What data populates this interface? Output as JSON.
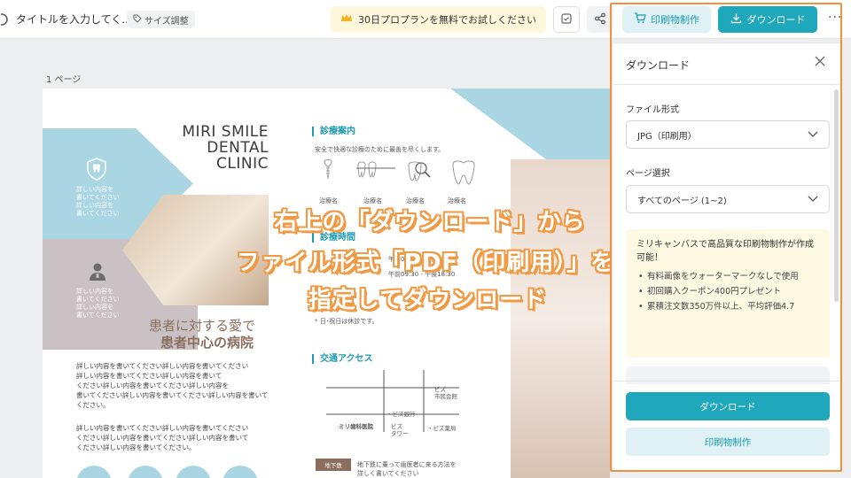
{
  "topbar": {
    "title": "タイトルを入力してく...",
    "size_button": "サイズ調整",
    "promo": "30日プロプランを無料でお試しください",
    "print_button": "印刷物制作",
    "download_button": "ダウンロード",
    "more": "···"
  },
  "canvas": {
    "page_label": "1 ページ",
    "doc": {
      "brand_line1": "MIRI SMILE",
      "brand_line2": "DENTAL",
      "brand_line3": "CLINIC",
      "side_text_1": "詳しい内容を\n書いてください\n詳しい内容を\n書いてください",
      "side_text_2": "詳しい内容を\n書いてください\n詳しい内容を\n書いてください",
      "slogan1": "患者に対する愛で",
      "slogan2": "患者中心の病院",
      "body1": "詳しい内容を書いてください詳しい内容を書いてください\n詳しい内容を書いてください詳しい内容を書いて\nください詳しい内容を書いてください詳しい内容を\n書いてください詳しい内容を書いてください詳しい内容を書いて\nください。",
      "body2": "詳しい内容を書いてください詳しい内容を書いてください\nください詳しい内容を書いてください詳しい内容を書いて\nください詳しい内容を書いてください。",
      "sec1": "診療案内",
      "sec1_sub": "安全で快適な診療のために最善を尽くします。",
      "tooth_labels": [
        "治療名",
        "治療名",
        "治療名",
        "治療名"
      ],
      "sec2": "診療時間",
      "hours1": "午前09:30 - 午後18:30",
      "hours2": "午前09:30 - 午後18:30",
      "holiday": "* 日･祝日は休診です。",
      "sec3": "交通アクセス",
      "map_bank": "・ビズ銀行",
      "map_city": "ビズ\n市民会館",
      "map_tower": "ビズ\nタワー",
      "map_pharmacy": "・ビズ薬局",
      "map_clinic": "ミリ歯科医院",
      "subway_tag": "地下鉄",
      "subway_text": "地下鉄に乗って歯医者に来る方法を\n詳しく書いてください"
    }
  },
  "overlay": {
    "line1": "右上の「ダウンロード」から",
    "line2": "ファイル形式「PDF（印刷用）」を",
    "line3": "指定してダウンロード"
  },
  "panel": {
    "title": "ダウンロード",
    "file_format_label": "ファイル形式",
    "file_format_value": "JPG（印刷用）",
    "page_select_label": "ページ選択",
    "page_select_value": "すべてのページ (1~2)",
    "promo_title": "ミリキャンバスで高品質な印刷物制作が作成可能！",
    "promo_items": [
      "有料画像をウォーターマークなしで使用",
      "初回購入クーポン400円プレゼント",
      "累積注文数350万件以上、平均評価4.7"
    ],
    "download_button": "ダウンロード",
    "print_button": "印刷物制作"
  },
  "colors": {
    "accent": "#1fa7bc",
    "highlight": "#f0913d",
    "promo_bg": "#fdf9e3"
  }
}
